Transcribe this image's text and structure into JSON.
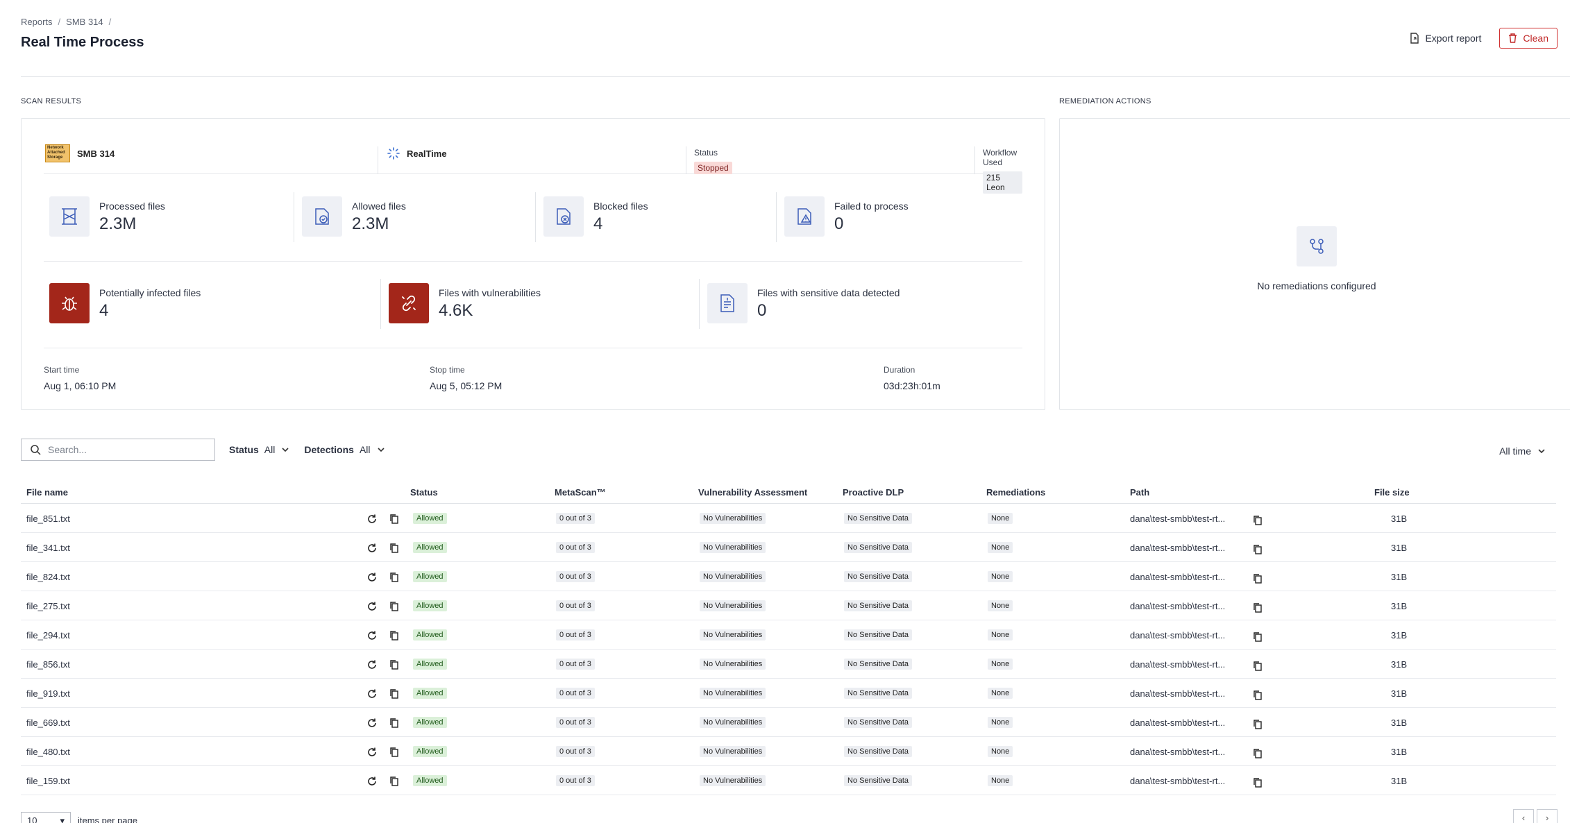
{
  "breadcrumb": [
    "Reports",
    "SMB 314"
  ],
  "page_title": "Real Time Process",
  "actions": {
    "export_label": "Export report",
    "clean_label": "Clean"
  },
  "sections": {
    "scan_results": "SCAN RESULTS",
    "remediation_actions": "REMEDIATION ACTIONS"
  },
  "scan": {
    "source_name": "SMB 314",
    "source_logo_text": "Network Attached Storage",
    "scan_type": "RealTime",
    "status_label": "Status",
    "status_value": "Stopped",
    "workflow_label": "Workflow Used",
    "workflow_value": "215 Leon",
    "stats_top": [
      {
        "label": "Processed files",
        "value": "2.3M",
        "icon": "processed-files-icon"
      },
      {
        "label": "Allowed files",
        "value": "2.3M",
        "icon": "allowed-files-icon"
      },
      {
        "label": "Blocked files",
        "value": "4",
        "icon": "blocked-files-icon"
      },
      {
        "label": "Failed to process",
        "value": "0",
        "icon": "failed-files-icon"
      }
    ],
    "stats_bottom": [
      {
        "label": "Potentially infected files",
        "value": "4",
        "icon": "bug-icon"
      },
      {
        "label": "Files with vulnerabilities",
        "value": "4.6K",
        "icon": "broken-link-icon"
      },
      {
        "label": "Files with sensitive data detected",
        "value": "0",
        "icon": "sensitive-doc-icon"
      }
    ],
    "start_label": "Start time",
    "start_value": "Aug 1, 06:10 PM",
    "stop_label": "Stop time",
    "stop_value": "Aug 5, 05:12 PM",
    "duration_label": "Duration",
    "duration_value": "03d:23h:01m"
  },
  "remediation": {
    "empty_text": "No remediations configured"
  },
  "filters": {
    "search_placeholder": "Search...",
    "status_label": "Status",
    "status_value": "All",
    "detections_label": "Detections",
    "detections_value": "All",
    "time_value": "All time"
  },
  "table": {
    "headers": {
      "file_name": "File name",
      "status": "Status",
      "metascan": "MetaScan™",
      "vulnerability": "Vulnerability Assessment",
      "dlp": "Proactive DLP",
      "remediations": "Remediations",
      "path": "Path",
      "size": "File size"
    },
    "rows": [
      {
        "name": "file_851.txt",
        "status": "Allowed",
        "metascan": "0 out of 3",
        "vuln": "No Vulnerabilities",
        "dlp": "No Sensitive Data",
        "remed": "None",
        "path": "dana\\test-smbb\\test-rt...",
        "size": "31B"
      },
      {
        "name": "file_341.txt",
        "status": "Allowed",
        "metascan": "0 out of 3",
        "vuln": "No Vulnerabilities",
        "dlp": "No Sensitive Data",
        "remed": "None",
        "path": "dana\\test-smbb\\test-rt...",
        "size": "31B"
      },
      {
        "name": "file_824.txt",
        "status": "Allowed",
        "metascan": "0 out of 3",
        "vuln": "No Vulnerabilities",
        "dlp": "No Sensitive Data",
        "remed": "None",
        "path": "dana\\test-smbb\\test-rt...",
        "size": "31B"
      },
      {
        "name": "file_275.txt",
        "status": "Allowed",
        "metascan": "0 out of 3",
        "vuln": "No Vulnerabilities",
        "dlp": "No Sensitive Data",
        "remed": "None",
        "path": "dana\\test-smbb\\test-rt...",
        "size": "31B"
      },
      {
        "name": "file_294.txt",
        "status": "Allowed",
        "metascan": "0 out of 3",
        "vuln": "No Vulnerabilities",
        "dlp": "No Sensitive Data",
        "remed": "None",
        "path": "dana\\test-smbb\\test-rt...",
        "size": "31B"
      },
      {
        "name": "file_856.txt",
        "status": "Allowed",
        "metascan": "0 out of 3",
        "vuln": "No Vulnerabilities",
        "dlp": "No Sensitive Data",
        "remed": "None",
        "path": "dana\\test-smbb\\test-rt...",
        "size": "31B"
      },
      {
        "name": "file_919.txt",
        "status": "Allowed",
        "metascan": "0 out of 3",
        "vuln": "No Vulnerabilities",
        "dlp": "No Sensitive Data",
        "remed": "None",
        "path": "dana\\test-smbb\\test-rt...",
        "size": "31B"
      },
      {
        "name": "file_669.txt",
        "status": "Allowed",
        "metascan": "0 out of 3",
        "vuln": "No Vulnerabilities",
        "dlp": "No Sensitive Data",
        "remed": "None",
        "path": "dana\\test-smbb\\test-rt...",
        "size": "31B"
      },
      {
        "name": "file_480.txt",
        "status": "Allowed",
        "metascan": "0 out of 3",
        "vuln": "No Vulnerabilities",
        "dlp": "No Sensitive Data",
        "remed": "None",
        "path": "dana\\test-smbb\\test-rt...",
        "size": "31B"
      },
      {
        "name": "file_159.txt",
        "status": "Allowed",
        "metascan": "0 out of 3",
        "vuln": "No Vulnerabilities",
        "dlp": "No Sensitive Data",
        "remed": "None",
        "path": "dana\\test-smbb\\test-rt...",
        "size": "31B"
      }
    ]
  },
  "pagination": {
    "page_size": "10",
    "items_per_page_label": "items per page"
  },
  "colors": {
    "accent_red": "#c02626",
    "icon_red": "#a3261a",
    "allowed_bg": "#dbf0d9",
    "stopped_bg": "#f9d9d7"
  }
}
